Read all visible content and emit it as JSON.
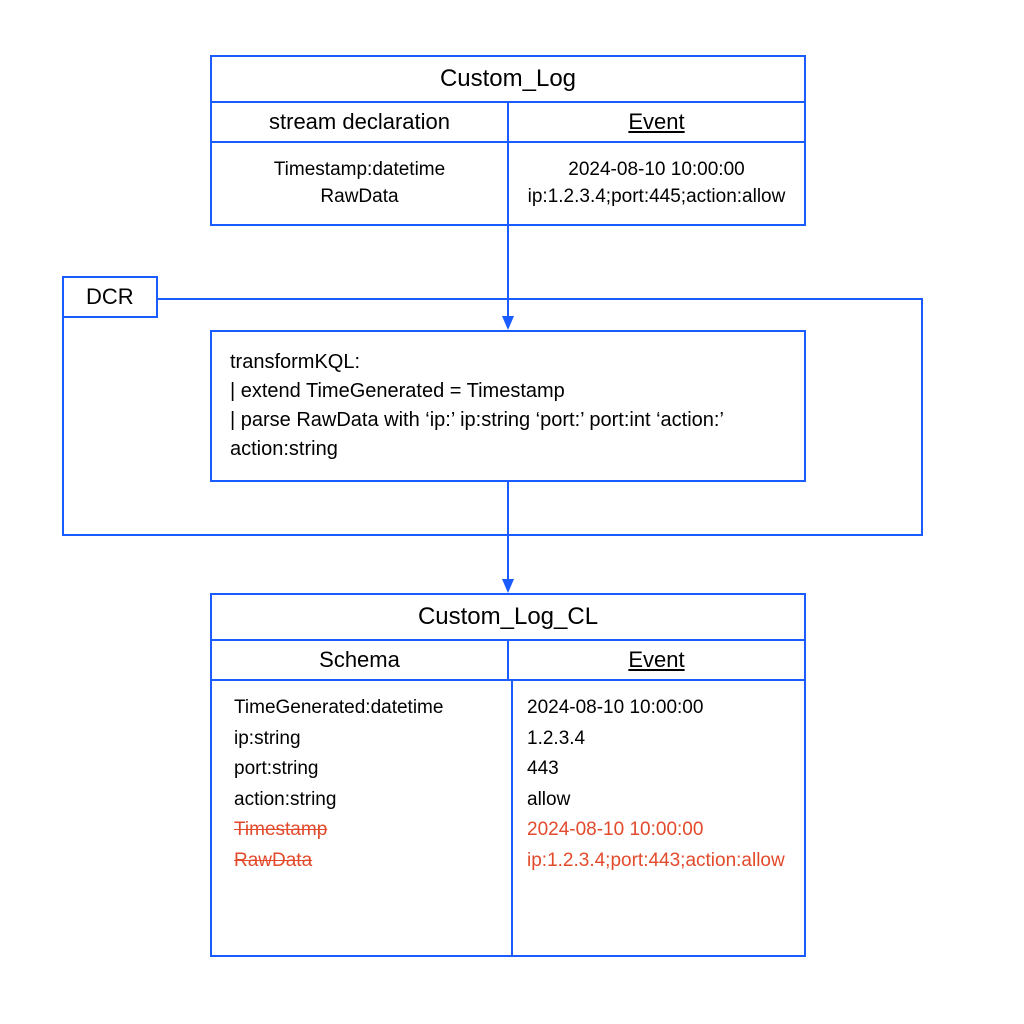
{
  "top_box": {
    "title": "Custom_Log",
    "left_header": "stream declaration",
    "right_header": "Event",
    "left_line1": "Timestamp:datetime",
    "left_line2": "RawData",
    "right_line1": "2024-08-10 10:00:00",
    "right_line2": "ip:1.2.3.4;port:445;action:allow"
  },
  "dcr_label": "DCR",
  "kql": {
    "l1": "transformKQL:",
    "l2": "| extend TimeGenerated = Timestamp",
    "l3": "| parse RawData with ‘ip:’ ip:string ‘port:’ port:int ‘action:’",
    "l4": "action:string"
  },
  "bottom_box": {
    "title": "Custom_Log_CL",
    "left_header": "Schema",
    "right_header": "Event",
    "schema": {
      "r1": "TimeGenerated:datetime",
      "r2": "ip:string",
      "r3": "port:string",
      "r4": "action:string",
      "r5": "Timestamp",
      "r6": "RawData"
    },
    "event": {
      "r1": "2024-08-10 10:00:00",
      "r2": "1.2.3.4",
      "r3": "443",
      "r4": "allow",
      "r5": "2024-08-10 10:00:00",
      "r6": "ip:1.2.3.4;port:443;action:allow"
    }
  }
}
